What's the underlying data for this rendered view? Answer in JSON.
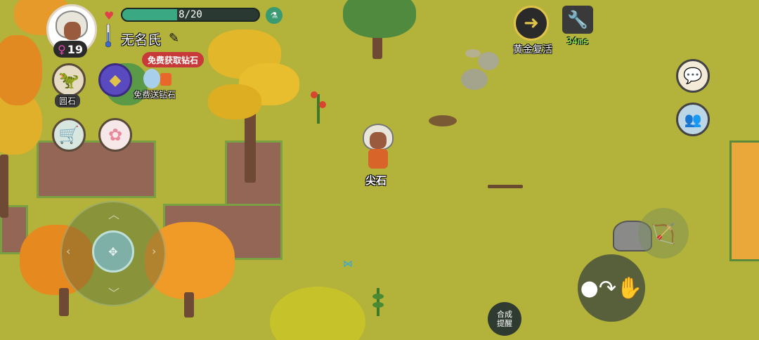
{
  "player": {
    "hp_text": "8/20",
    "hp_fraction": 0.4,
    "name": "无名氏",
    "level": "19",
    "gender_icon": "female-icon"
  },
  "menu": {
    "item1_label": "圆石",
    "promo_label": "免费获取钻石",
    "item2_label": "免费送钻石"
  },
  "top_right": {
    "revive_label": "黄金复活",
    "ping": "34ms"
  },
  "world": {
    "character_label": "尖石"
  },
  "controls": {
    "craft_label_line1": "合成",
    "craft_label_line2": "提醒"
  },
  "colors": {
    "grass": "#b3b23a",
    "dirt": "#946656",
    "hp": "#3aa882",
    "accent_gold": "#e0c34a",
    "promo_red": "#c83a3a"
  }
}
